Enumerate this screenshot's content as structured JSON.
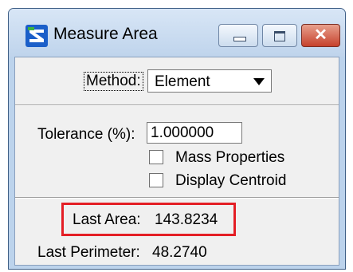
{
  "window": {
    "title": "Measure Area",
    "icon": "microstation-icon",
    "accent_color": "#bcd3ec"
  },
  "titlebar_buttons": {
    "minimize": "minimize-icon",
    "maximize": "maximize-icon",
    "close": "close-icon",
    "close_color": "#c6412c"
  },
  "method": {
    "label": "Method:",
    "selected": "Element"
  },
  "tolerance": {
    "label": "Tolerance (%):",
    "value": "1.000000"
  },
  "options": [
    {
      "label": "Mass Properties",
      "checked": false
    },
    {
      "label": "Display Centroid",
      "checked": false
    }
  ],
  "results": {
    "last_area_label": "Last Area:",
    "last_area_value": "143.8234",
    "last_perimeter_label": "Last Perimeter:",
    "last_perimeter_value": "48.2740",
    "highlight_color": "#e41e25"
  }
}
